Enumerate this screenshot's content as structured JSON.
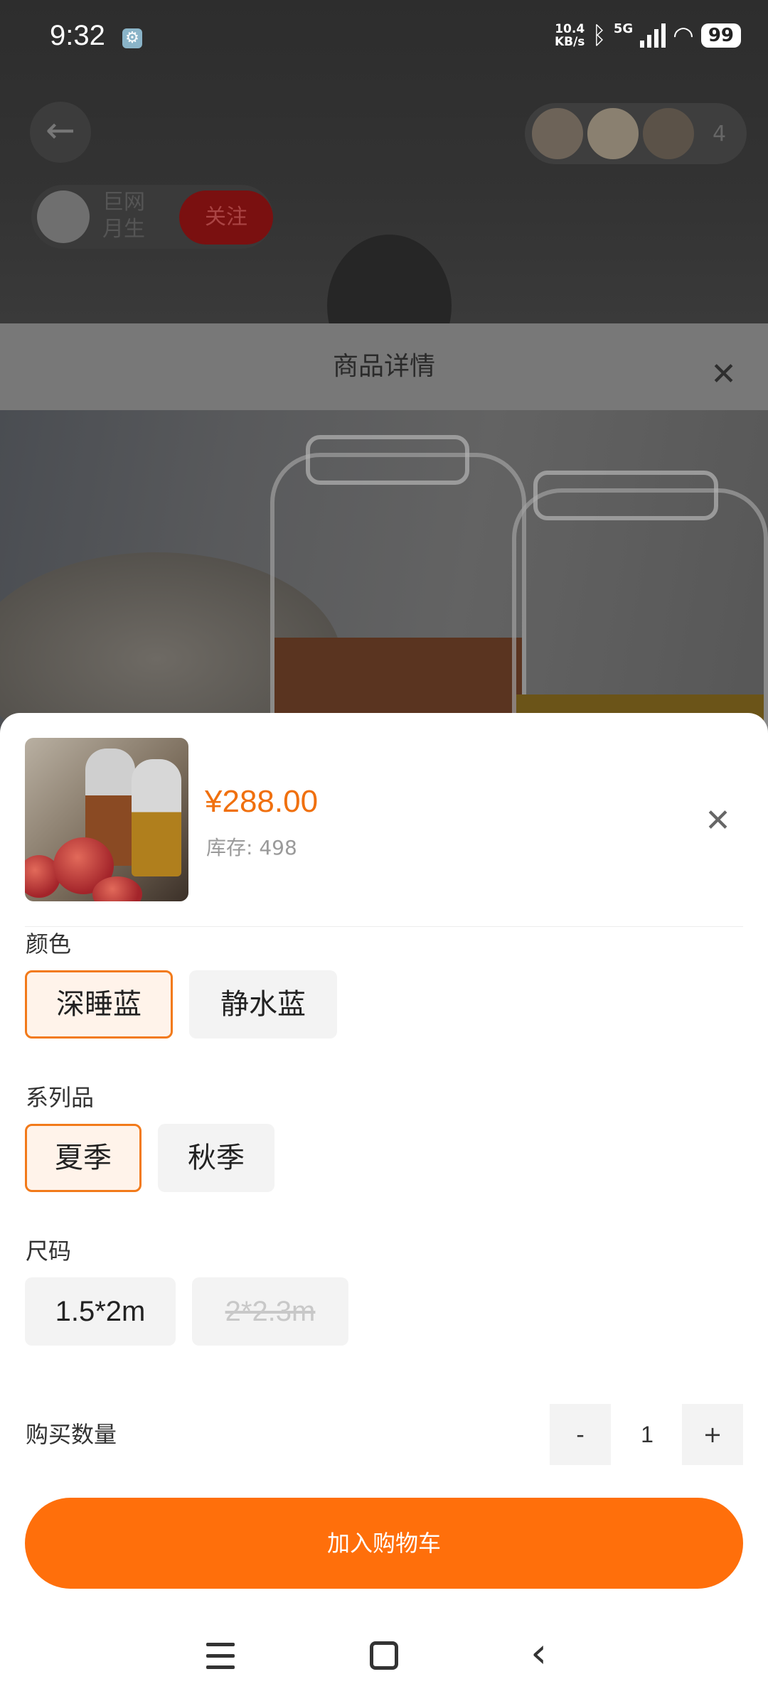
{
  "status_bar": {
    "time": "9:32",
    "net_speed_value": "10.4",
    "net_speed_unit": "KB/s",
    "network": "5G",
    "battery": "99"
  },
  "live_room": {
    "host_name_line1": "巨网",
    "host_name_line2": "月生",
    "follow_label": "关注",
    "viewer_count": "4"
  },
  "product_detail": {
    "title": "商品详情"
  },
  "sku_sheet": {
    "price": "¥288.00",
    "stock": "库存: 498",
    "groups": [
      {
        "label": "颜色",
        "options": [
          {
            "label": "深睡蓝",
            "state": "selected"
          },
          {
            "label": "静水蓝",
            "state": "normal"
          }
        ]
      },
      {
        "label": "系列品",
        "options": [
          {
            "label": "夏季",
            "state": "selected"
          },
          {
            "label": "秋季",
            "state": "normal"
          }
        ]
      },
      {
        "label": "尺码",
        "options": [
          {
            "label": "1.5*2m",
            "state": "normal"
          },
          {
            "label": "2*2.3m",
            "state": "disabled"
          }
        ]
      }
    ],
    "quantity_label": "购买数量",
    "quantity": "1",
    "minus_label": "-",
    "plus_label": "+",
    "add_to_cart_label": "加入购物车"
  },
  "colors": {
    "accent": "#ff6f0b",
    "price": "#f0700e",
    "selected_border": "#f27a1a"
  },
  "icons": [
    "settings-icon",
    "bluetooth-icon",
    "signal-icon",
    "wifi-icon",
    "battery-icon",
    "back-arrow-icon",
    "close-icon",
    "nav-menu-icon",
    "nav-home-icon",
    "nav-back-icon"
  ]
}
